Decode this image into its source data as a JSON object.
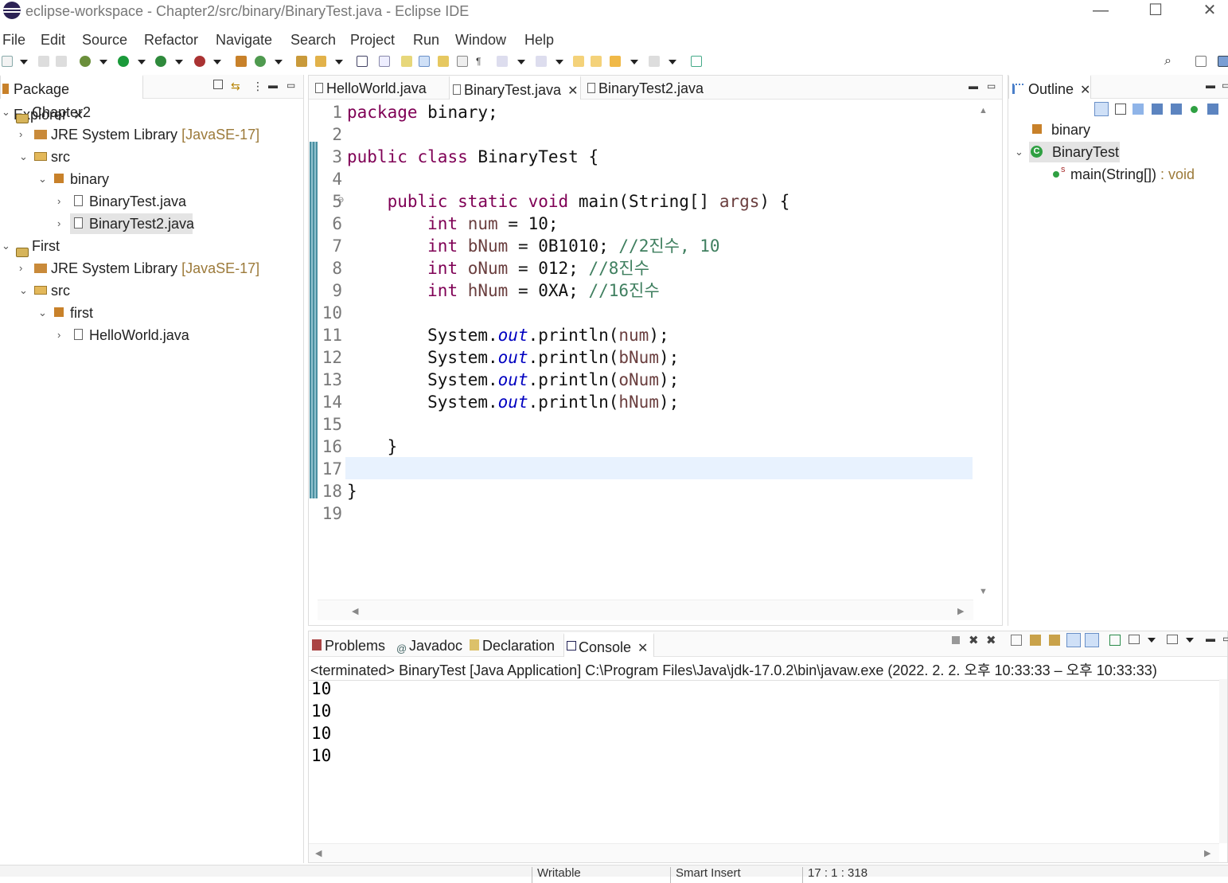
{
  "window": {
    "title": "eclipse-workspace - Chapter2/src/binary/BinaryTest.java - Eclipse IDE",
    "minimize": "—",
    "maximize": "☐",
    "close": "✕"
  },
  "menu": [
    "File",
    "Edit",
    "Source",
    "Refactor",
    "Navigate",
    "Search",
    "Project",
    "Run",
    "Window",
    "Help"
  ],
  "package_explorer": {
    "tab_label": "Package Explorer",
    "tree": [
      {
        "label": "Chapter2",
        "decoration": ""
      },
      {
        "label": "JRE System Library",
        "decoration": "[JavaSE-17]"
      },
      {
        "label": "src",
        "decoration": ""
      },
      {
        "label": "binary",
        "decoration": ""
      },
      {
        "label": "BinaryTest.java",
        "decoration": ""
      },
      {
        "label": "BinaryTest2.java",
        "decoration": ""
      },
      {
        "label": "First",
        "decoration": ""
      },
      {
        "label": "JRE System Library",
        "decoration": "[JavaSE-17]"
      },
      {
        "label": "src",
        "decoration": ""
      },
      {
        "label": "first",
        "decoration": ""
      },
      {
        "label": "HelloWorld.java",
        "decoration": ""
      }
    ]
  },
  "editor": {
    "tabs": [
      "HelloWorld.java",
      "BinaryTest.java",
      "BinaryTest2.java"
    ],
    "active_tab": "BinaryTest.java",
    "line_numbers": [
      "1",
      "2",
      "3",
      "4",
      "5",
      "6",
      "7",
      "8",
      "9",
      "10",
      "11",
      "12",
      "13",
      "14",
      "15",
      "16",
      "17",
      "18",
      "19"
    ],
    "current_line": "17"
  },
  "outline": {
    "tab_label": "Outline",
    "items": [
      {
        "label": "binary"
      },
      {
        "label": "BinaryTest"
      },
      {
        "label": "main(String[])",
        "type": " : void"
      }
    ]
  },
  "console": {
    "tabs": [
      "Problems",
      "Javadoc",
      "Declaration",
      "Console"
    ],
    "active_tab": "Console",
    "header": "<terminated> BinaryTest [Java Application] C:\\Program Files\\Java\\jdk-17.0.2\\bin\\javaw.exe  (2022. 2. 2. 오후 10:33:33 – 오후 10:33:33)",
    "output": [
      "10",
      "10",
      "10",
      "10"
    ]
  },
  "status": {
    "writable": "Writable",
    "insert_mode": "Smart Insert",
    "position": "17 : 1 : 318"
  },
  "colors": {
    "keyword": "#7f0055",
    "static_field": "#0000c0",
    "comment": "#3f7f5f",
    "local_var": "#6a3e3e",
    "current_line": "#e8f2fe"
  }
}
